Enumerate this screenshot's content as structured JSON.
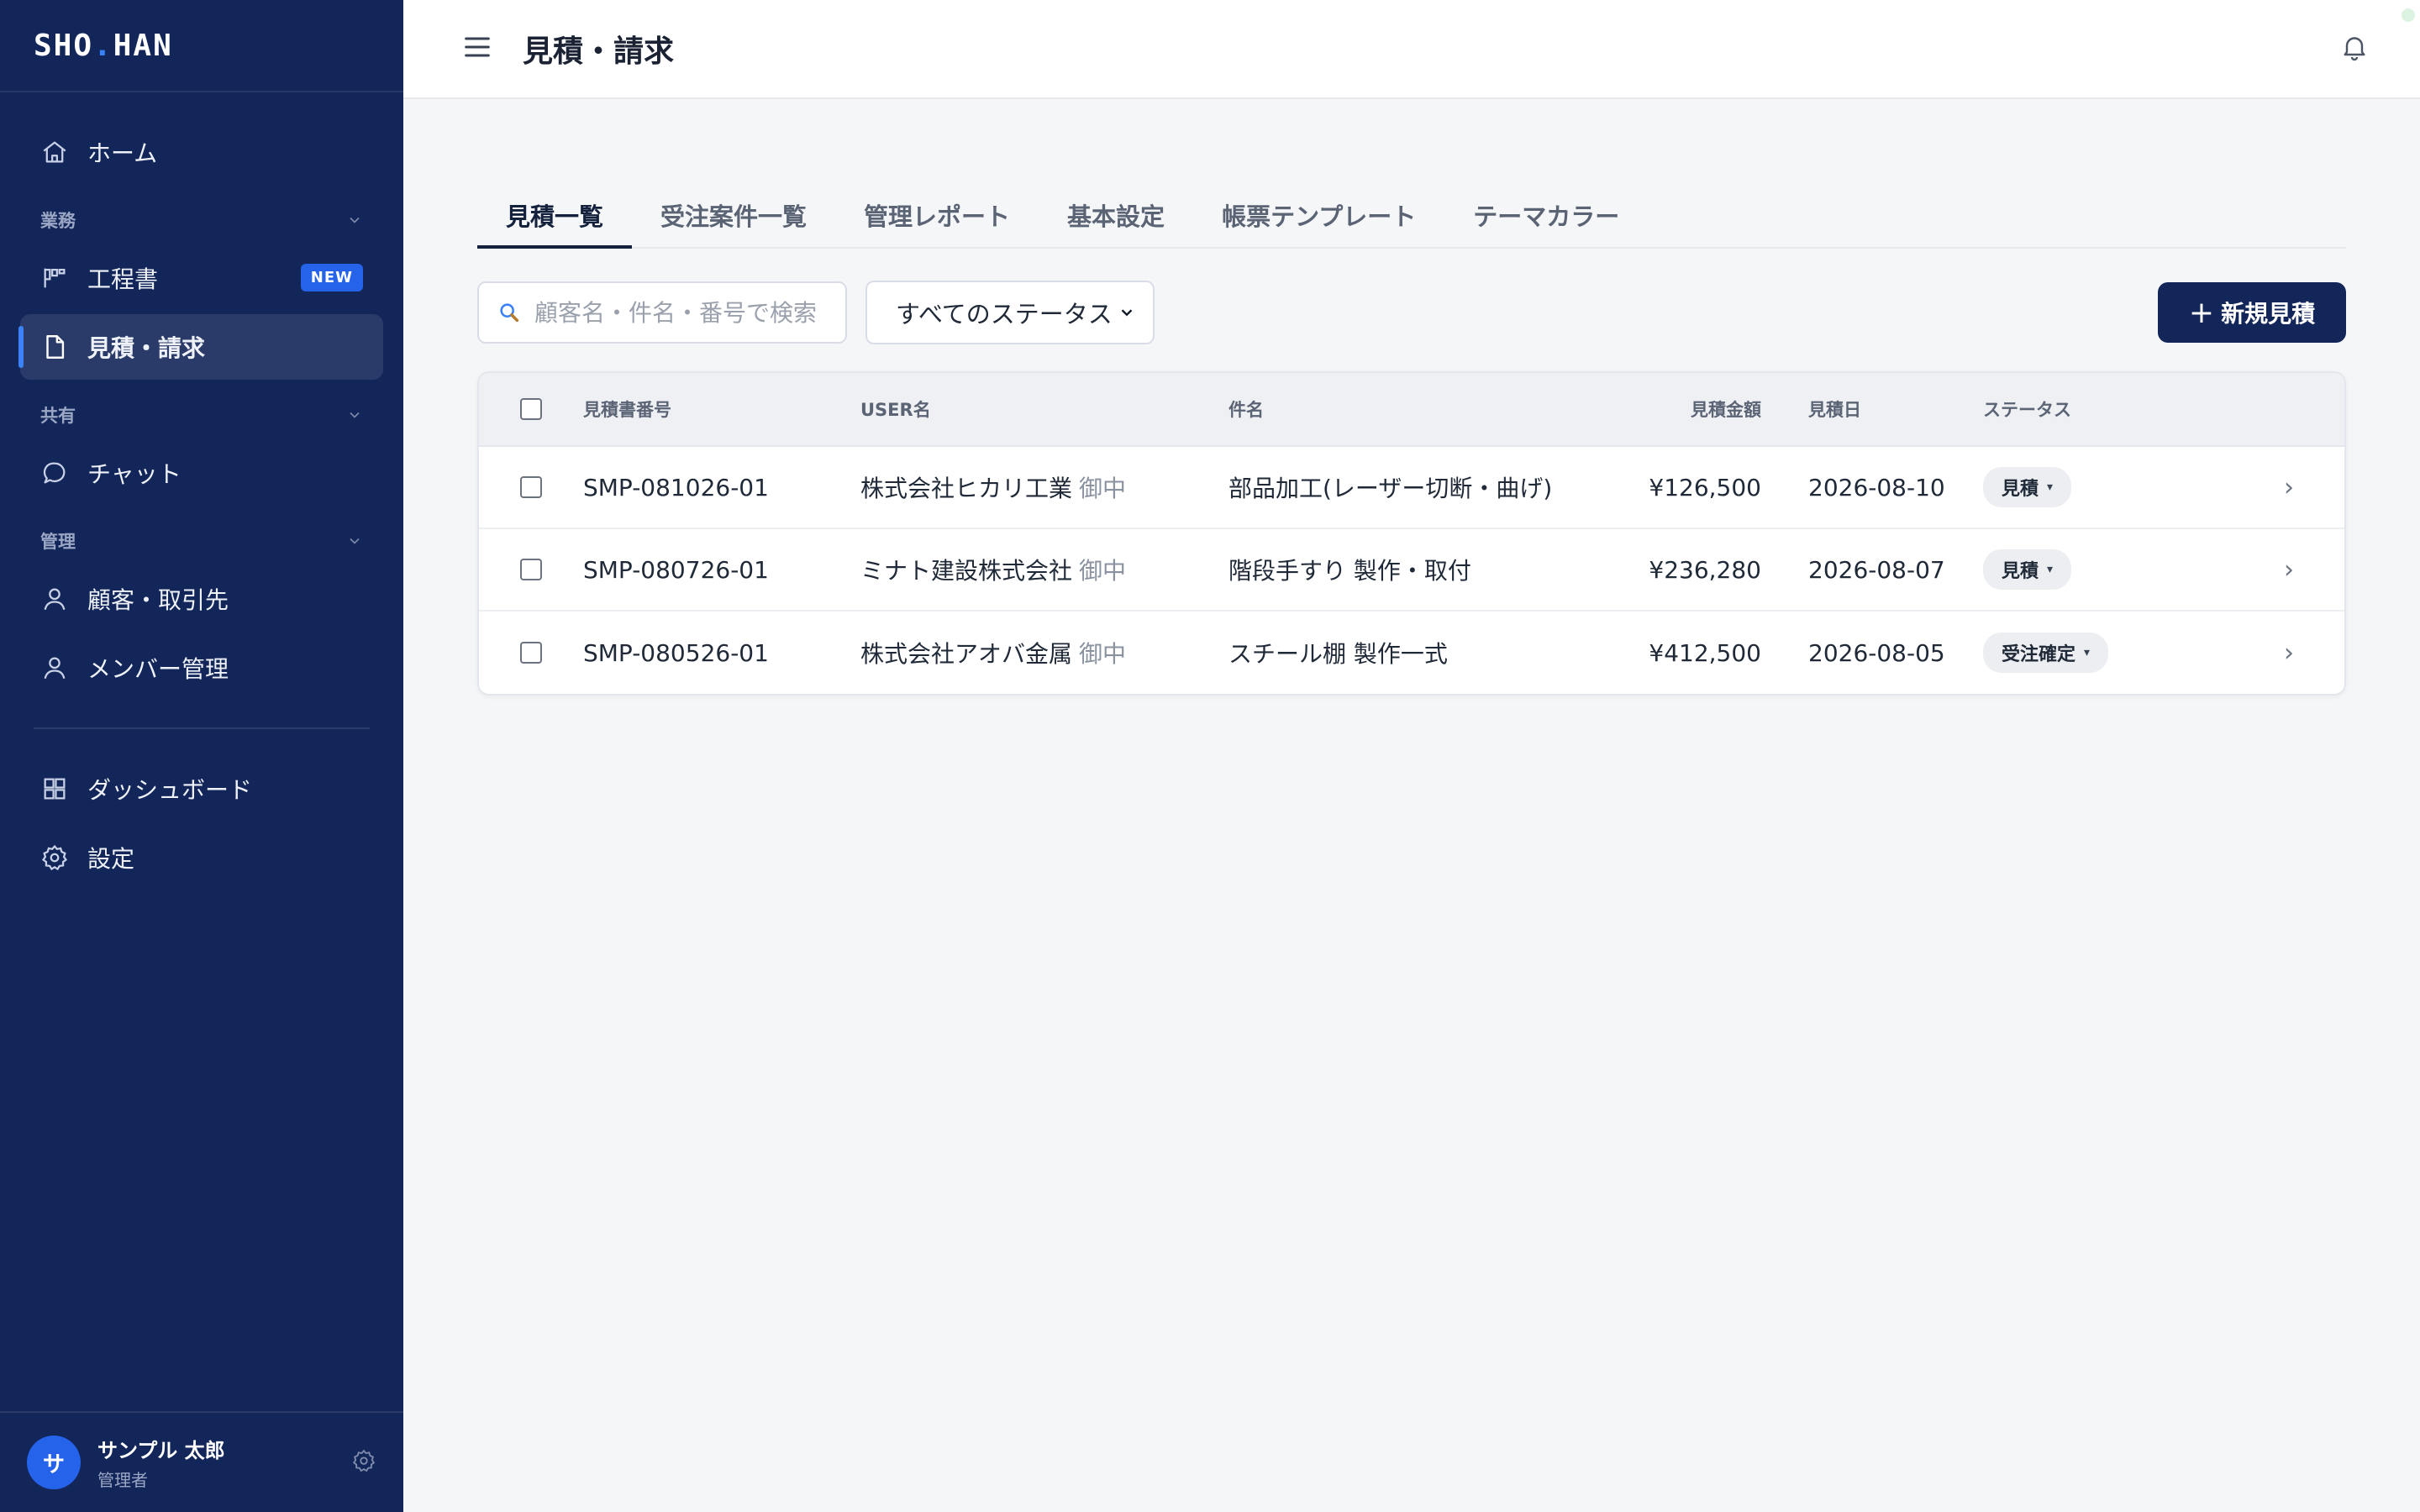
{
  "brand": {
    "name_left": "SHO",
    "name_right": "HAN"
  },
  "sidebar": {
    "home": "ホーム",
    "sections": [
      {
        "label": "業務",
        "items": [
          {
            "label": "工程書",
            "badge": "NEW"
          },
          {
            "label": "見積・請求"
          }
        ]
      },
      {
        "label": "共有",
        "items": [
          {
            "label": "チャット"
          }
        ]
      },
      {
        "label": "管理",
        "items": [
          {
            "label": "顧客・取引先"
          },
          {
            "label": "メンバー管理"
          }
        ]
      }
    ],
    "bottom_items": [
      {
        "label": "ダッシュボード"
      },
      {
        "label": "設定"
      }
    ],
    "user": {
      "avatar_initial": "サ",
      "name": "サンプル 太郎",
      "role": "管理者"
    }
  },
  "header": {
    "title": "見積・請求"
  },
  "tabs": [
    "見積一覧",
    "受注案件一覧",
    "管理レポート",
    "基本設定",
    "帳票テンプレート",
    "テーマカラー"
  ],
  "toolbar": {
    "search_placeholder": "顧客名・件名・番号で検索",
    "status_filter": "すべてのステータス",
    "new_button": "新規見積"
  },
  "table": {
    "columns": [
      "見積書番号",
      "USER名",
      "件名",
      "見積金額",
      "見積日",
      "ステータス"
    ],
    "rows": [
      {
        "number": "SMP-081026-01",
        "user": "株式会社ヒカリ工業",
        "suffix": "御中",
        "subject": "部品加工(レーザー切断・曲げ)",
        "amount": "¥126,500",
        "date": "2026-08-10",
        "status": "見積"
      },
      {
        "number": "SMP-080726-01",
        "user": "ミナト建設株式会社",
        "suffix": "御中",
        "subject": "階段手すり 製作・取付",
        "amount": "¥236,280",
        "date": "2026-08-07",
        "status": "見積"
      },
      {
        "number": "SMP-080526-01",
        "user": "株式会社アオバ金属",
        "suffix": "御中",
        "subject": "スチール棚 製作一式",
        "amount": "¥412,500",
        "date": "2026-08-05",
        "status": "受注確定"
      }
    ]
  },
  "icons": {
    "home": "home-icon",
    "process": "kanban-icon",
    "document": "document-icon",
    "chat": "chat-bubble-icon",
    "customer": "person-icon",
    "member": "person-icon",
    "dashboard": "grid-icon",
    "settings": "gear-icon",
    "menu": "hamburger-icon",
    "bell": "bell-icon",
    "search": "search-icon"
  },
  "colors": {
    "sidebar_bg": "#13265a",
    "accent": "#2563eb",
    "primary_button": "#13265a"
  }
}
